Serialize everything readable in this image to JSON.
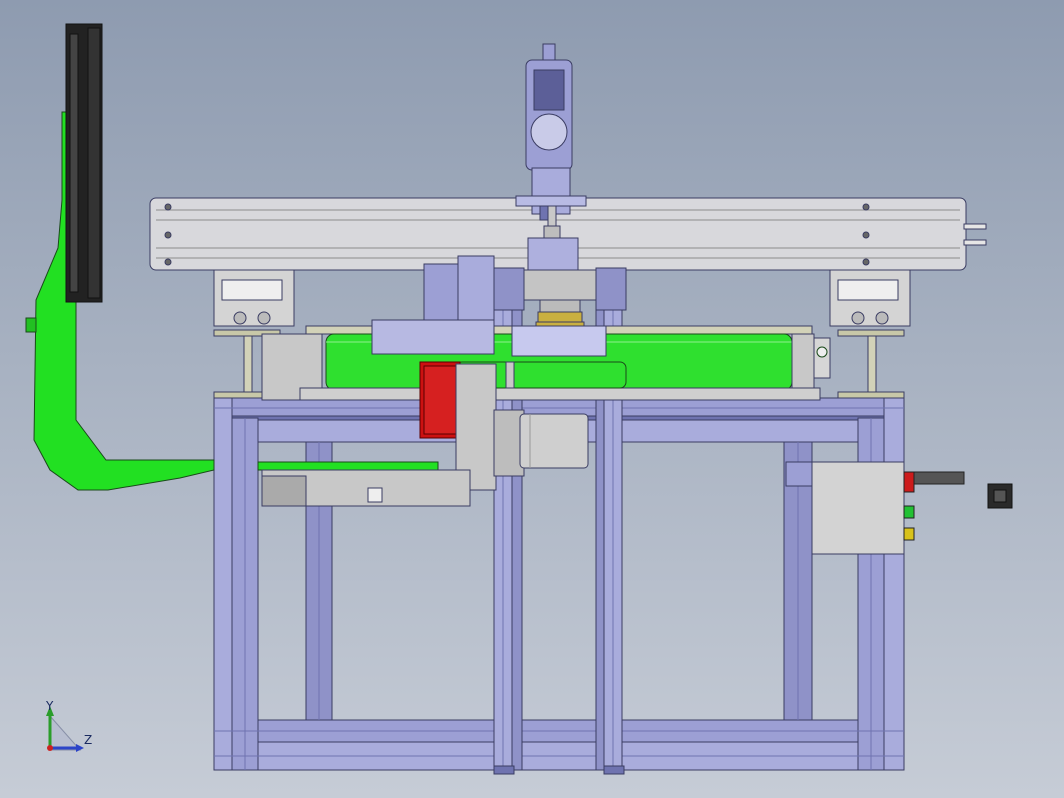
{
  "viewport": {
    "background_top": "#8e9bb0",
    "background_bottom": "#c6ccd6"
  },
  "model": {
    "colors": {
      "frame": "#9c9fd4",
      "frame_dark": "#6f73b0",
      "frame_outline": "#3a3c62",
      "accent_green": "#22e022",
      "roller_green": "#2fe02f",
      "red_block": "#cc1111",
      "steel": "#c8c8c8",
      "steel_dark": "#8c8c8c",
      "gold_ring": "#c9b040",
      "panel_grey": "#d3d3d3",
      "monitor_black": "#222222",
      "light_green": "#22c033",
      "light_yellow": "#d8c21a",
      "light_red": "#cc1b1b"
    }
  },
  "triad": {
    "y_label": "Y",
    "z_label": "Z",
    "y_color": "#2a9d2a",
    "z_color": "#2c44c8",
    "x_color": "#c22"
  }
}
